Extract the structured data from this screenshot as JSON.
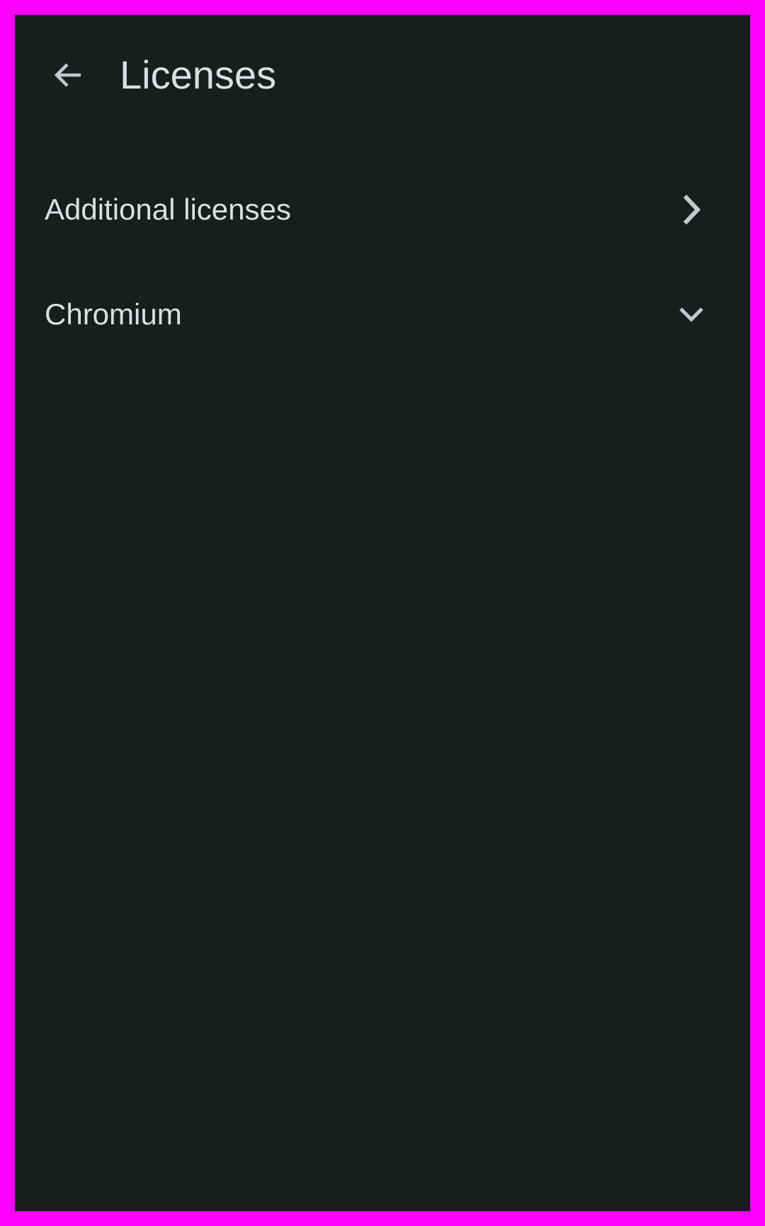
{
  "toolbar": {
    "back_icon": "arrow-back-icon",
    "title": "Licenses"
  },
  "list": {
    "items": [
      {
        "label": "Additional licenses",
        "icon": "chevron-right-icon"
      },
      {
        "label": "Chromium",
        "icon": "chevron-down-icon"
      }
    ]
  },
  "colors": {
    "frame": "#ff00ff",
    "background": "#1a1d1e",
    "text": "#dcdfe2",
    "icon": "#c4c7cf"
  }
}
